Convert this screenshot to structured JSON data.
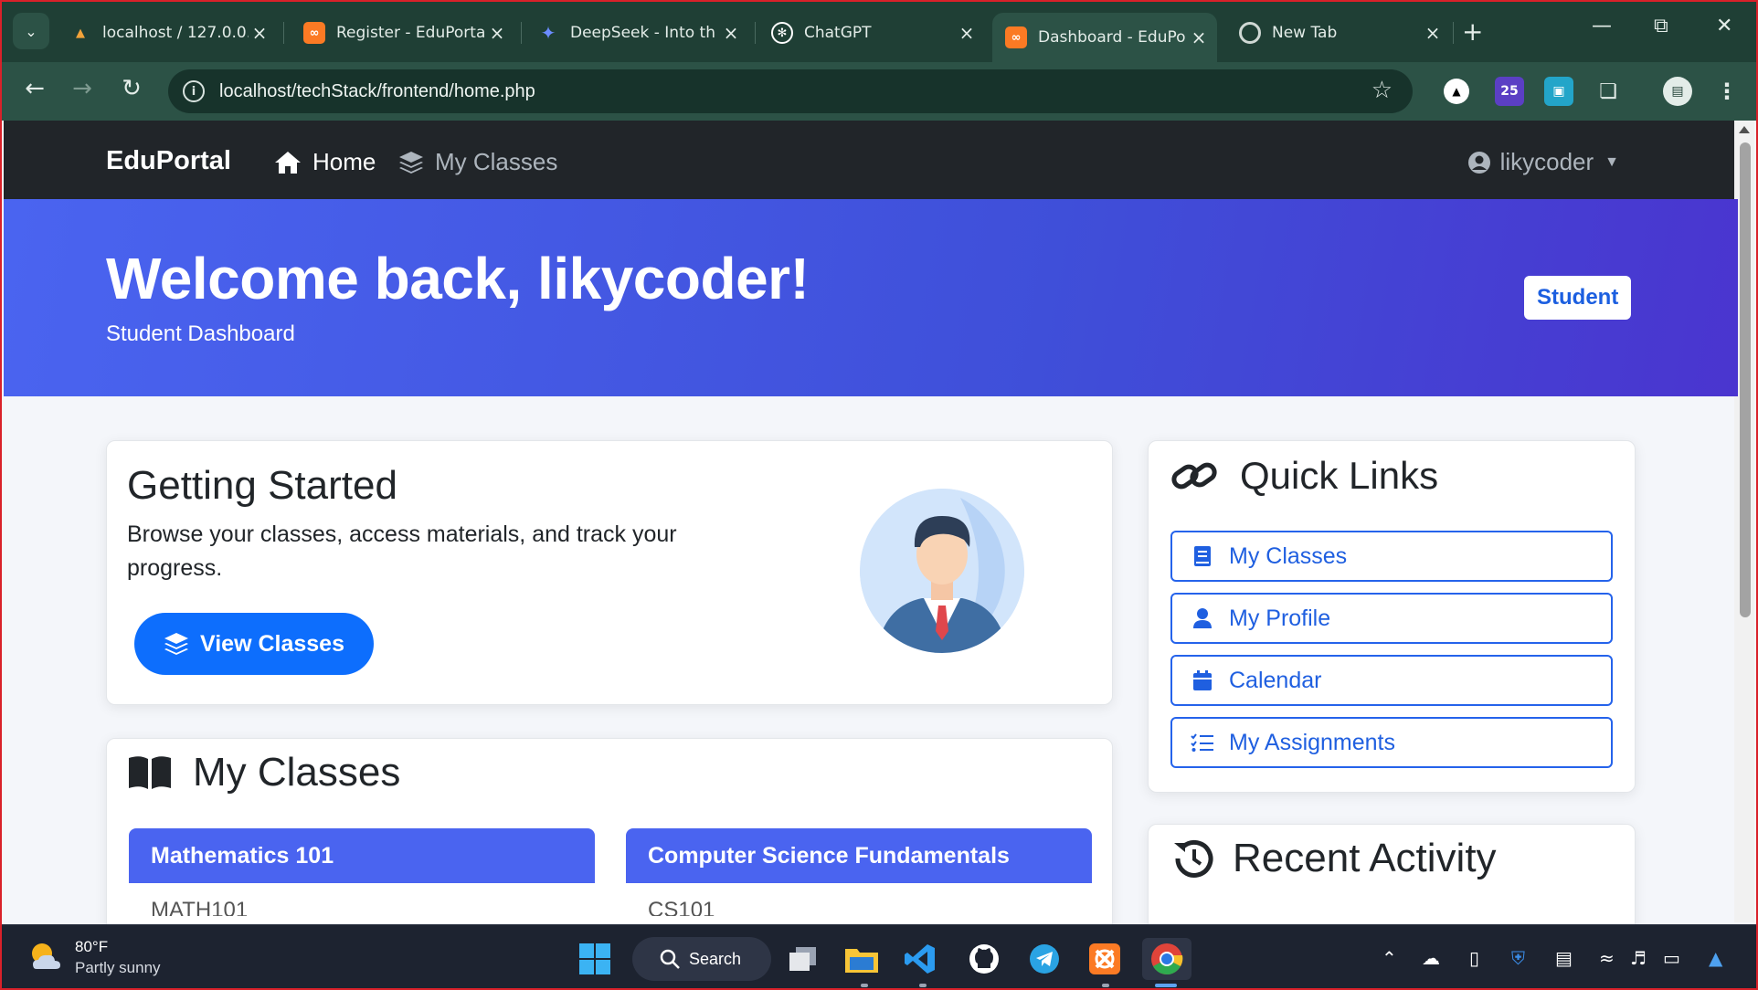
{
  "browser": {
    "tabs": [
      {
        "title": "localhost / 127.0.0.",
        "icon": "phpmyadmin-icon",
        "active": false
      },
      {
        "title": "Register - EduPorta",
        "icon": "xampp-icon",
        "active": false
      },
      {
        "title": "DeepSeek - Into th",
        "icon": "deepseek-icon",
        "active": false
      },
      {
        "title": "ChatGPT",
        "icon": "chatgpt-icon",
        "active": false
      },
      {
        "title": "Dashboard - EduPo",
        "icon": "xampp-icon",
        "active": true
      },
      {
        "title": "New Tab",
        "icon": "chrome-icon",
        "active": false
      }
    ],
    "url": "localhost/techStack/frontend/home.php",
    "extension_badge": "25"
  },
  "navbar": {
    "brand": "EduPortal",
    "links": [
      {
        "label": "Home",
        "icon": "home-icon",
        "active": true
      },
      {
        "label": "My Classes",
        "icon": "layers-icon",
        "active": false
      }
    ],
    "user": "likycoder"
  },
  "hero": {
    "title": "Welcome back, likycoder!",
    "subtitle": "Student Dashboard",
    "role_badge": "Student"
  },
  "getting_started": {
    "title": "Getting Started",
    "text": "Browse your classes, access materials, and track your progress.",
    "button": "View Classes"
  },
  "quick_links": {
    "title": "Quick Links",
    "items": [
      {
        "label": "My Classes",
        "icon": "book-icon"
      },
      {
        "label": "My Profile",
        "icon": "user-icon"
      },
      {
        "label": "Calendar",
        "icon": "calendar-icon"
      },
      {
        "label": "My Assignments",
        "icon": "tasks-icon"
      }
    ]
  },
  "my_classes": {
    "title": "My Classes",
    "classes": [
      {
        "name": "Mathematics 101",
        "code": "MATH101"
      },
      {
        "name": "Computer Science Fundamentals",
        "code": "CS101"
      }
    ]
  },
  "recent_activity": {
    "title": "Recent Activity"
  },
  "taskbar": {
    "temperature": "80°F",
    "condition": "Partly sunny",
    "search_label": "Search"
  },
  "colors": {
    "primary": "#0d6efd",
    "hero_start": "#4a64f0",
    "hero_end": "#4a35cf",
    "navbar": "#212529",
    "chrome_bg": "#1f3f35"
  }
}
